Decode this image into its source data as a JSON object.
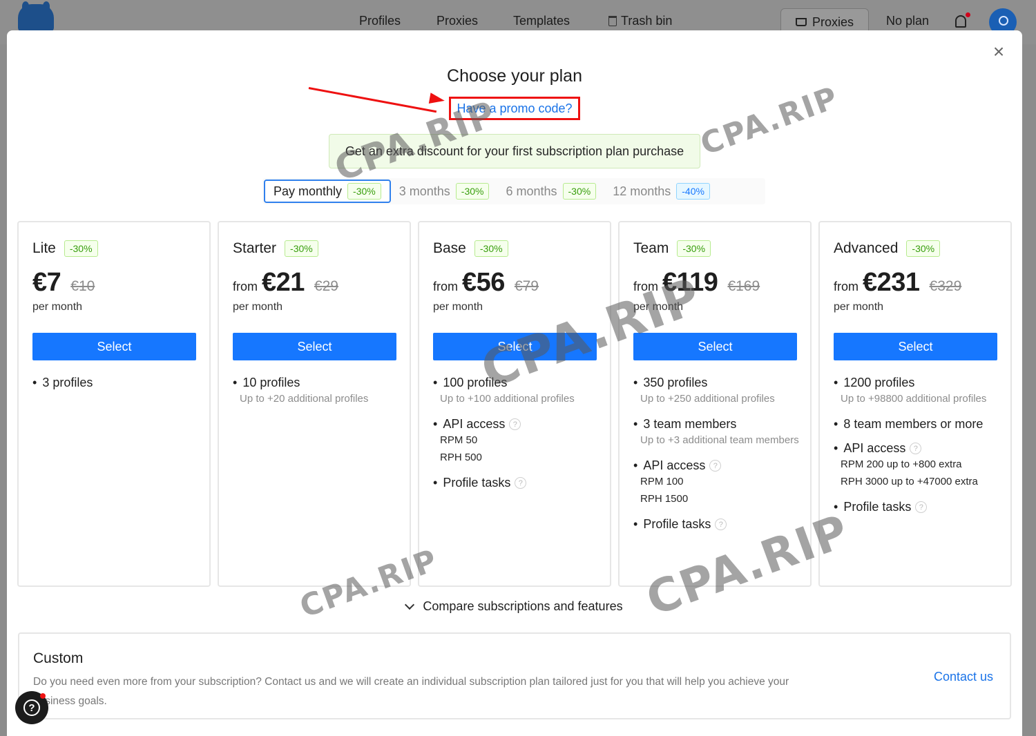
{
  "nav": {
    "links": [
      "Profiles",
      "Proxies",
      "Templates",
      "Trash bin"
    ],
    "proxies_button": "Proxies",
    "plan_status": "No plan"
  },
  "modal": {
    "title": "Choose your plan",
    "promo_link": "Have a promo code?",
    "banner": "Get an extra discount for your first subscription plan purchase",
    "periods": [
      {
        "label": "Pay monthly",
        "discount": "-30%"
      },
      {
        "label": "3 months",
        "discount": "-30%"
      },
      {
        "label": "6 months",
        "discount": "-30%"
      },
      {
        "label": "12 months",
        "discount": "-40%"
      }
    ],
    "plans": [
      {
        "name": "Lite",
        "discount": "-30%",
        "from": "",
        "price": "€7",
        "old_price": "€10",
        "per": "per month",
        "button": "Select",
        "features": [
          {
            "main": "3 profiles",
            "subs": []
          }
        ]
      },
      {
        "name": "Starter",
        "discount": "-30%",
        "from": "from",
        "price": "€21",
        "old_price": "€29",
        "per": "per month",
        "button": "Select",
        "features": [
          {
            "main": "10 profiles",
            "subs": [
              "Up to +20 additional profiles"
            ]
          }
        ]
      },
      {
        "name": "Base",
        "discount": "-30%",
        "from": "from",
        "price": "€56",
        "old_price": "€79",
        "per": "per month",
        "button": "Select",
        "features": [
          {
            "main": "100 profiles",
            "subs": [
              "Up to +100 additional profiles"
            ]
          },
          {
            "main": "API access",
            "help": true,
            "subs": [
              "RPM 50",
              "RPH 500"
            ],
            "dark": true
          },
          {
            "main": "Profile tasks",
            "help": true,
            "subs": []
          }
        ]
      },
      {
        "name": "Team",
        "discount": "-30%",
        "from": "from",
        "price": "€119",
        "old_price": "€169",
        "per": "per month",
        "button": "Select",
        "features": [
          {
            "main": "350 profiles",
            "subs": [
              "Up to +250 additional profiles"
            ]
          },
          {
            "main": "3 team members",
            "subs": [
              "Up to +3 additional team members"
            ]
          },
          {
            "main": "API access",
            "help": true,
            "subs": [
              "RPM 100",
              "RPH 1500"
            ],
            "dark": true
          },
          {
            "main": "Profile tasks",
            "help": true,
            "subs": []
          }
        ]
      },
      {
        "name": "Advanced",
        "discount": "-30%",
        "from": "from",
        "price": "€231",
        "old_price": "€329",
        "per": "per month",
        "button": "Select",
        "features": [
          {
            "main": "1200 profiles",
            "subs": [
              "Up to +98800 additional profiles"
            ]
          },
          {
            "main": "8 team members or more",
            "subs": []
          },
          {
            "main": "API access",
            "help": true,
            "subs": [
              "RPM 200 up to +800 extra",
              "RPH 3000 up to +47000 extra"
            ],
            "dark": true
          },
          {
            "main": "Profile tasks",
            "help": true,
            "subs": []
          }
        ]
      }
    ],
    "compare": "Compare subscriptions and features",
    "custom": {
      "title": "Custom",
      "text": "Do you need even more from your subscription? Contact us and we will create an individual subscription plan tailored just for you that will help you achieve your business goals.",
      "contact": "Contact us"
    }
  },
  "watermark": "CPA.RIP",
  "colors": {
    "accent": "#1677ff",
    "annotation": "#ee1111",
    "tag_green": "#389e0d",
    "tag_blue": "#1677ff"
  }
}
